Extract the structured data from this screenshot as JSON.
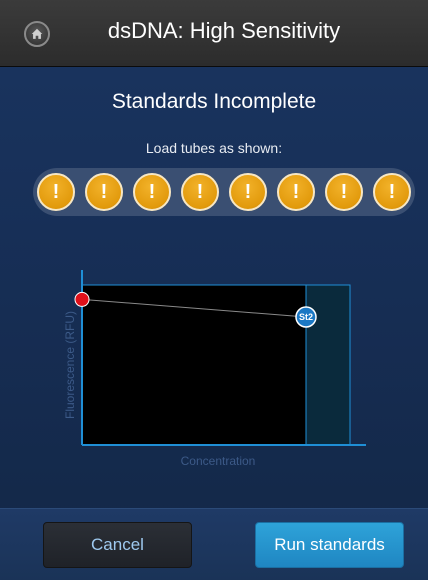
{
  "header": {
    "title": "dsDNA: High Sensitivity",
    "home_icon": "home-icon"
  },
  "status": {
    "title": "Standards Incomplete",
    "instruction": "Load tubes as shown:"
  },
  "tubes": [
    {
      "symbol": "!"
    },
    {
      "symbol": "!"
    },
    {
      "symbol": "!"
    },
    {
      "symbol": "!"
    },
    {
      "symbol": "!"
    },
    {
      "symbol": "!"
    },
    {
      "symbol": "!"
    },
    {
      "symbol": "!"
    }
  ],
  "colors": {
    "tube_warning": "#e29a0c",
    "point_st1": "#e0101a",
    "point_st2": "#1b78c4",
    "axis": "#1f8fd6",
    "run_button": "#2396cf"
  },
  "chart_data": {
    "type": "scatter",
    "xlabel": "Concentration",
    "ylabel": "Fluorescence (RFU)",
    "points": [
      {
        "label": "",
        "x": 0,
        "y": 0.91,
        "color": "#e0101a"
      },
      {
        "label": "St2",
        "x": 1,
        "y": 0.8,
        "color": "#1b78c4"
      }
    ],
    "grid": false
  },
  "footer": {
    "cancel_label": "Cancel",
    "run_label": "Run standards"
  }
}
